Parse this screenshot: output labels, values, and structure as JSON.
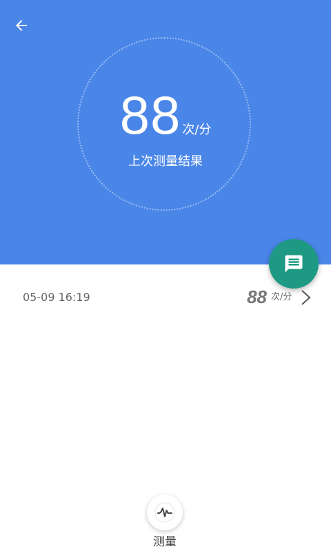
{
  "colors": {
    "header_bg": "#4a86e8",
    "fab_bg": "#1e9a84",
    "text_white": "#ffffff",
    "text_gray": "#666666"
  },
  "header": {
    "back_icon": "arrow-left-icon",
    "last_result": {
      "value": "88",
      "unit": "次/分",
      "label": "上次测量结果"
    }
  },
  "fab": {
    "icon": "message-icon"
  },
  "records": [
    {
      "time": "05-09 16:19",
      "value": "88",
      "unit": "次/分",
      "icon": "chevron-right-icon"
    }
  ],
  "bottom": {
    "measure_icon": "heartbeat-wave-icon",
    "measure_label": "测量"
  }
}
